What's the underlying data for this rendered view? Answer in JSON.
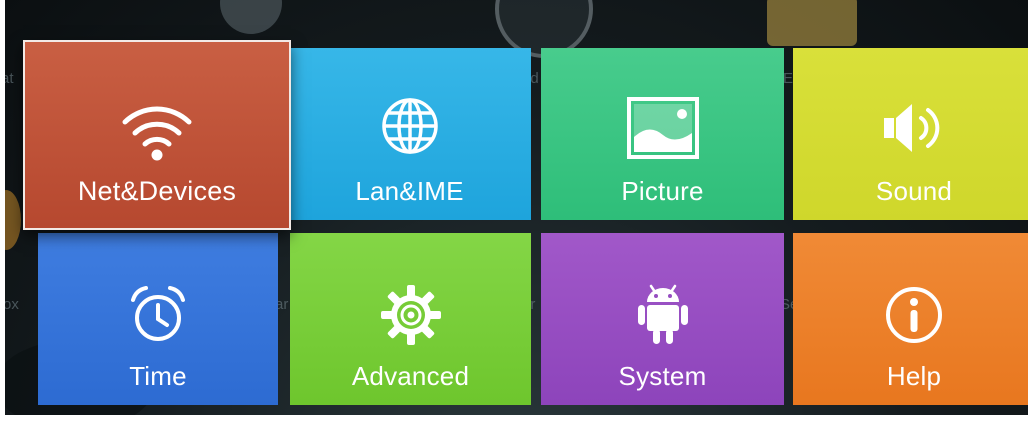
{
  "tiles": [
    {
      "id": "net",
      "label": "Net&Devices",
      "icon": "wifi-icon",
      "color": "#c0553a",
      "focused": true
    },
    {
      "id": "lan",
      "label": "Lan&IME",
      "icon": "globe-icon",
      "color": "#2aaee2"
    },
    {
      "id": "pic",
      "label": "Picture",
      "icon": "picture-icon",
      "color": "#3cc584"
    },
    {
      "id": "snd",
      "label": "Sound",
      "icon": "speaker-icon",
      "color": "#d4db33"
    },
    {
      "id": "time",
      "label": "Time",
      "icon": "alarm-clock-icon",
      "color": "#3574d9"
    },
    {
      "id": "adv",
      "label": "Advanced",
      "icon": "gear-icon",
      "color": "#79ce3a"
    },
    {
      "id": "sys",
      "label": "System",
      "icon": "android-icon",
      "color": "#974ec2"
    },
    {
      "id": "help",
      "label": "Help",
      "icon": "info-icon",
      "color": "#ec8029"
    }
  ],
  "background_fragments": [
    "at",
    "id",
    "Ei",
    "ox",
    "ar",
    "ir",
    "Se"
  ]
}
